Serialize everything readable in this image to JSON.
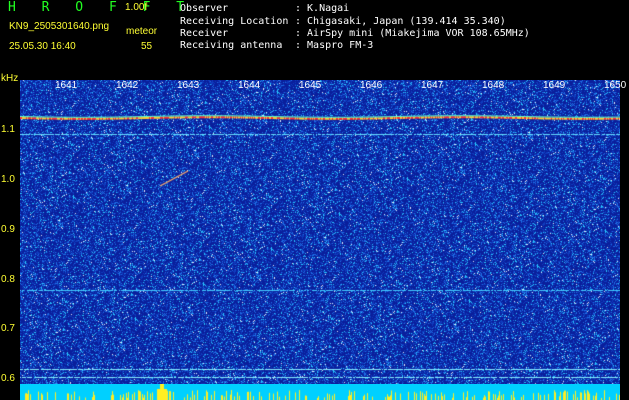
{
  "header": {
    "title": "H R O F F T",
    "version": "1.00f",
    "filename": "KN9_2505301640.png",
    "meteor_label": "meteor",
    "timestamp": "25.05.30 16:40",
    "meteor_count": "55"
  },
  "station": [
    {
      "key": "Observer",
      "value": ": K.Nagai"
    },
    {
      "key": "Receiving Location",
      "value": ": Chigasaki, Japan (139.414 35.340)"
    },
    {
      "key": "Receiver",
      "value": ": AirSpy mini (Miakejima VOR 108.65MHz)"
    },
    {
      "key": "Receiving antenna",
      "value": ": Maspro FM-3"
    }
  ],
  "spectrogram": {
    "frequency_unit": "kHz",
    "time_ticks": [
      "1641",
      "1642",
      "1643",
      "1644",
      "1645",
      "1646",
      "1647",
      "1648",
      "1649",
      "1650"
    ],
    "freq_ticks": [
      "1.1",
      "1.0",
      "0.9",
      "0.8",
      "0.7",
      "0.6"
    ],
    "colors": {
      "background": "#0a1f9c",
      "noise": "#28a0ff",
      "carrier": "#ff3030",
      "label_yellow": "#ffff33",
      "title_green": "#22ff22",
      "bottom_bar": "#00d0ff"
    }
  }
}
